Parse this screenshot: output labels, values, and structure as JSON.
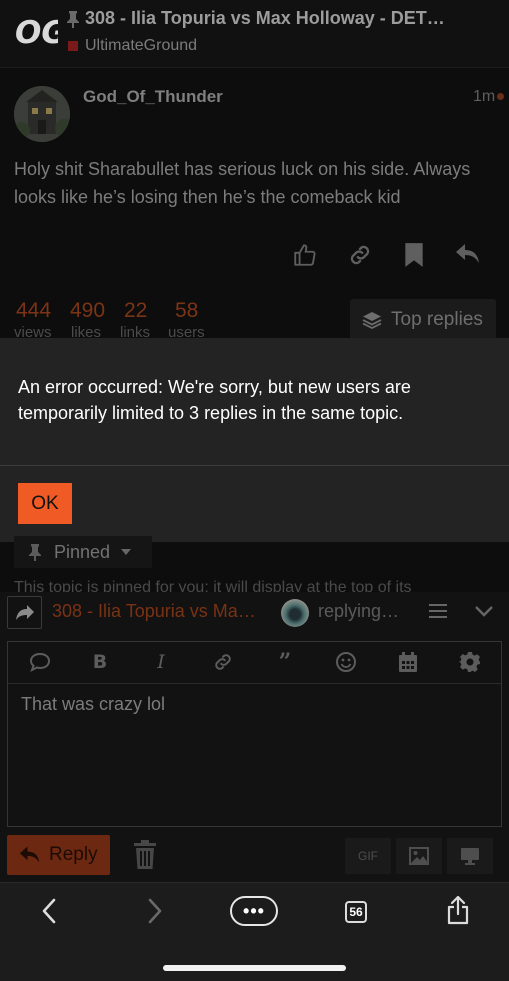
{
  "header": {
    "logo_text": "OG",
    "topic_title": "308 - Ilia Topuria vs Max Holloway - DET…",
    "category": "UltimateGround",
    "colors": {
      "category_square": "#7a1a1a",
      "logo_text": "#d9d9d9"
    }
  },
  "post": {
    "author": "God_Of_Thunder",
    "time": "1m",
    "body": "Holy shit Sharabullet has serious luck on his side. Always looks like he’s losing then he’s the comeback kid",
    "actions": [
      "like-icon",
      "link-icon",
      "bookmark-icon",
      "reply-icon"
    ]
  },
  "stats": {
    "views": {
      "value": "444",
      "label": "views"
    },
    "likes": {
      "value": "490",
      "label": "likes"
    },
    "links": {
      "value": "22",
      "label": "links"
    },
    "users": {
      "value": "58",
      "label": "users"
    },
    "top_replies_label": "Top replies"
  },
  "modal": {
    "message": "An error occurred: We're sorry, but new users are temporarily limited to 3 replies in the same topic.",
    "ok_label": "OK",
    "accent": "#f05a24"
  },
  "pinned": {
    "label": "Pinned",
    "note": "This topic is pinned for you; it will display at the top of its"
  },
  "composer": {
    "topic": "308 - Ilia Topuria vs Ma…",
    "replying": "replying…",
    "toolbar": [
      "quote-icon",
      "bold-icon",
      "italic-icon",
      "link-icon",
      "blockquote-icon",
      "emoji-icon",
      "calendar-icon",
      "settings-gear-icon"
    ],
    "text": "That was crazy lol",
    "reply_label": "Reply",
    "gif_label": "GIF"
  },
  "browser": {
    "more_label": "•••",
    "tab_count": "56"
  }
}
